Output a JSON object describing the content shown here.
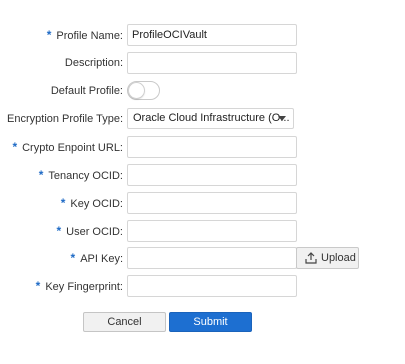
{
  "form": {
    "fields": [
      {
        "id": "profile-name",
        "label": "Profile Name:",
        "required": true,
        "value": "ProfileOCIVault"
      },
      {
        "id": "description",
        "label": "Description:",
        "required": false,
        "value": ""
      },
      {
        "id": "default-profile",
        "label": "Default Profile:",
        "required": false,
        "type": "toggle",
        "checked": false
      },
      {
        "id": "encryption-profile-type",
        "label": "Encryption Profile Type:",
        "required": false,
        "type": "select",
        "value": "Oracle Cloud Infrastructure (O..."
      },
      {
        "id": "crypto-endpoint-url",
        "label": "Crypto Enpoint URL:",
        "required": true,
        "value": ""
      },
      {
        "id": "tenancy-ocid",
        "label": "Tenancy OCID:",
        "required": true,
        "value": ""
      },
      {
        "id": "key-ocid",
        "label": "Key OCID:",
        "required": true,
        "value": ""
      },
      {
        "id": "user-ocid",
        "label": "User OCID:",
        "required": true,
        "value": ""
      },
      {
        "id": "api-key",
        "label": "API Key:",
        "required": true,
        "value": ""
      },
      {
        "id": "key-fingerprint",
        "label": "Key Fingerprint:",
        "required": true,
        "value": ""
      }
    ],
    "required_marker": "*",
    "upload_label": "Upload",
    "upload_icon": "upload-icon",
    "cancel_label": "Cancel",
    "submit_label": "Submit"
  },
  "colors": {
    "accent": "#1d6fd1",
    "required_marker": "#1f6bc6"
  }
}
